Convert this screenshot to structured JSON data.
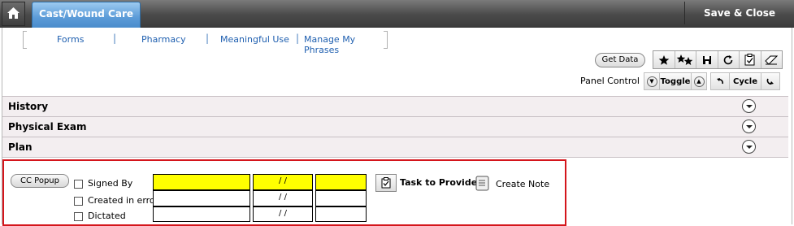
{
  "topbar": {
    "home_icon": "home-icon",
    "active_tab": "Cast/Wound Care",
    "save_close": "Save & Close"
  },
  "nav": {
    "links": [
      "Forms",
      "Pharmacy",
      "Meaningful Use",
      "Manage My Phrases"
    ],
    "separator": "|"
  },
  "toolbar": {
    "get_data": "Get Data",
    "icons": [
      "star-icon",
      "multi-star-icon",
      "save-icon",
      "refresh-icon",
      "clipboard-check-icon",
      "eraser-icon"
    ]
  },
  "panel_control": {
    "label": "Panel Control",
    "toggle": "Toggle",
    "cycle": "Cycle"
  },
  "sections": [
    "History",
    "Physical Exam",
    "Plan"
  ],
  "plan": {
    "cc_popup": "CC Popup",
    "checkboxes": [
      "Signed By",
      "Created in error",
      "Dictated"
    ],
    "date_placeholder": " / /",
    "task_to_provider": "Task to Provider",
    "create_note": "Create Note"
  },
  "colors": {
    "active_tab": "#5b9bd8",
    "highlight_field": "#ffff00",
    "focus_border": "#d4151b"
  }
}
